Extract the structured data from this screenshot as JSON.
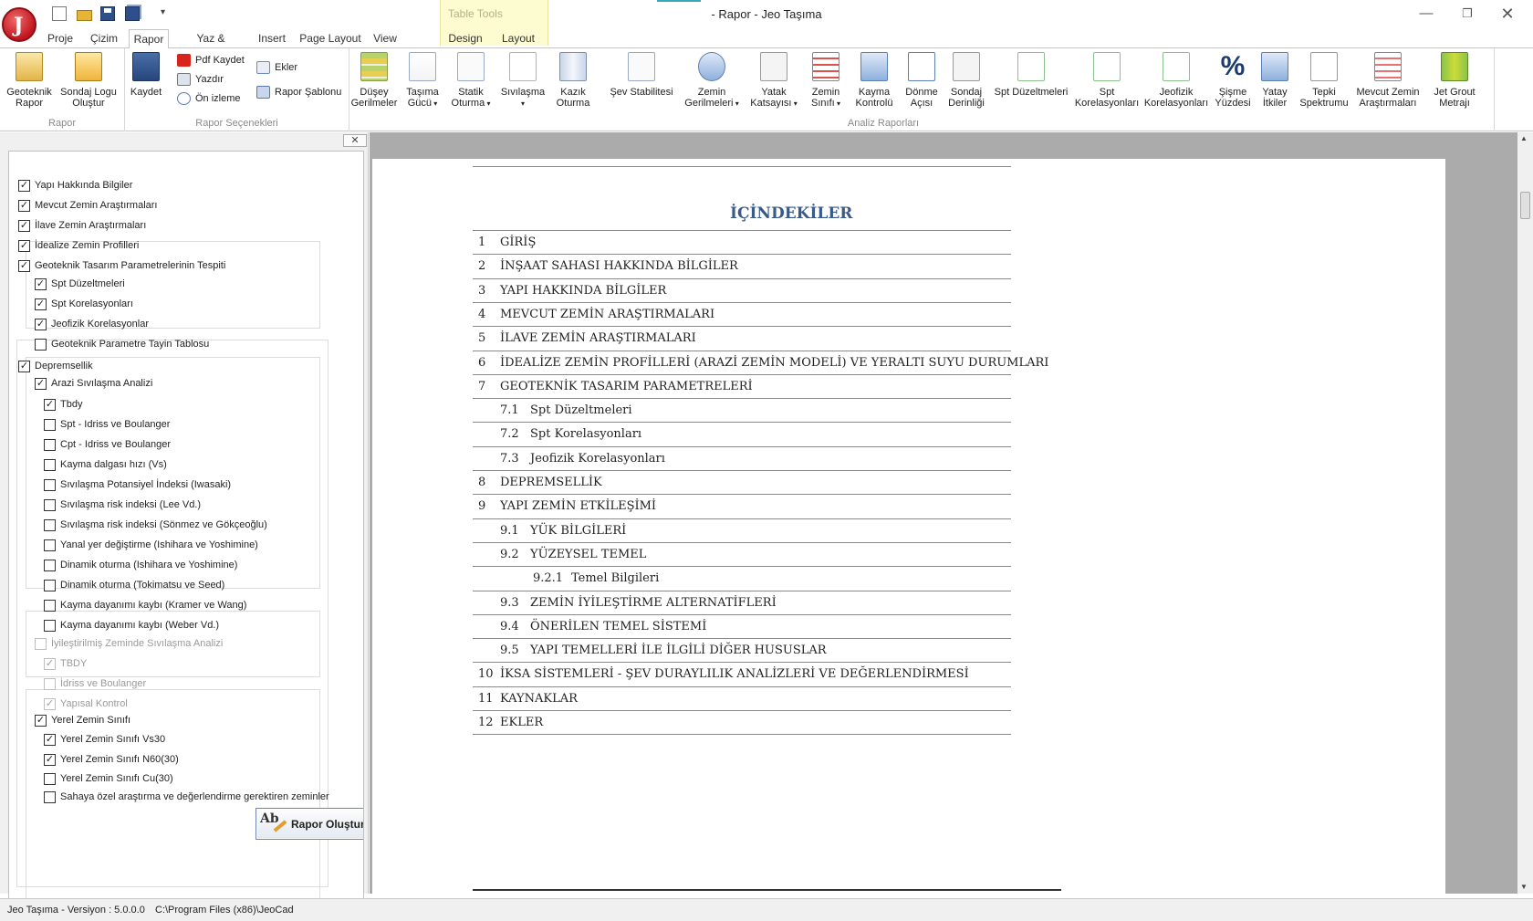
{
  "window": {
    "title": "- Rapor - Jeo Taşıma",
    "app_logo_letter": "J",
    "contextual_tab_group": "Table Tools",
    "minimize": "—",
    "maximize": "❐",
    "close": "✕"
  },
  "tabs": [
    "Proje",
    "Çizim",
    "Rapor",
    "Yaz & Düzenle",
    "Insert",
    "Page Layout",
    "View",
    "Design",
    "Layout"
  ],
  "active_tab": "Rapor",
  "ribbon": {
    "groups": {
      "rapor": "Rapor",
      "secenekler": "Rapor Seçenekleri",
      "analiz": "Analiz Raporları"
    },
    "rapor_buttons": [
      {
        "label1": "Geoteknik",
        "label2": "Rapor"
      },
      {
        "label1": "Sondaj Logu",
        "label2": "Oluştur"
      }
    ],
    "kaydet": "Kaydet",
    "pdf_kaydet": "Pdf Kaydet",
    "yazdir": "Yazdır",
    "on_izleme": "Ön izleme",
    "ekler": "Ekler",
    "rapor_sablonu": "Rapor Şablonu",
    "analiz_buttons": [
      {
        "label1": "Düşey",
        "label2": "Gerilmeler",
        "icon": "stress-layers-icon"
      },
      {
        "label1": "Taşıma",
        "label2": "Gücü",
        "icon": "bearing-capacity-icon"
      },
      {
        "label1": "Statik",
        "label2": "Oturma",
        "icon": "static-settlement-icon"
      },
      {
        "label1": "Sıvılaşma",
        "label2": "",
        "icon": "liquefaction-icon"
      },
      {
        "label1": "Kazık",
        "label2": "Oturma",
        "icon": "pile-settlement-icon"
      },
      {
        "label1": "Şev Stabilitesi",
        "label2": "",
        "icon": "slope-stability-icon"
      },
      {
        "label1": "Zemin",
        "label2": "Gerilmeleri",
        "icon": "soil-stress-icon"
      },
      {
        "label1": "Yatak",
        "label2": "Katsayısı",
        "icon": "subgrade-modulus-icon"
      },
      {
        "label1": "Zemin",
        "label2": "Sınıfı",
        "icon": "soil-class-icon"
      },
      {
        "label1": "Kayma",
        "label2": "Kontrolü",
        "icon": "sliding-check-icon"
      },
      {
        "label1": "Dönme",
        "label2": "Açısı",
        "icon": "rotation-angle-icon"
      },
      {
        "label1": "Sondaj",
        "label2": "Derinliği",
        "icon": "boring-depth-icon"
      },
      {
        "label1": "Spt Düzeltmeleri",
        "label2": "",
        "icon": "spt-correction-icon"
      },
      {
        "label1": "Spt",
        "label2": "Korelasyonları",
        "icon": "spt-correlation-icon"
      },
      {
        "label1": "Jeofizik",
        "label2": "Korelasyonları",
        "icon": "geophysics-correlation-icon"
      },
      {
        "label1": "Şişme",
        "label2": "Yüzdesi",
        "icon": "percent-icon",
        "glyph": "%"
      },
      {
        "label1": "Yatay",
        "label2": "İtkiler",
        "icon": "lateral-pressure-icon"
      },
      {
        "label1": "Tepki",
        "label2": "Spektrumu",
        "icon": "response-spectrum-icon"
      },
      {
        "label1": "Mevcut Zemin",
        "label2": "Araştırmaları",
        "icon": "existing-survey-icon"
      },
      {
        "label1": "Jet Grout",
        "label2": "Metrajı",
        "icon": "jet-grout-icon"
      }
    ]
  },
  "tree": {
    "close": "✕",
    "items": [
      {
        "label": "Yapı Hakkında Bilgiler",
        "checked": true,
        "enabled": true
      },
      {
        "label": "Mevcut Zemin Araştırmaları",
        "checked": true,
        "enabled": true
      },
      {
        "label": "İlave Zemin Araştırmaları",
        "checked": true,
        "enabled": true
      },
      {
        "label": "İdealize Zemin Profilleri",
        "checked": true,
        "enabled": true
      },
      {
        "label": "Geoteknik Tasarım Parametrelerinin Tespiti",
        "checked": true,
        "enabled": true
      },
      {
        "label": "Spt Düzeltmeleri",
        "checked": true,
        "enabled": true
      },
      {
        "label": "Spt Korelasyonları",
        "checked": true,
        "enabled": true
      },
      {
        "label": "Jeofizik Korelasyonlar",
        "checked": true,
        "enabled": true
      },
      {
        "label": "Geoteknik Parametre Tayin Tablosu",
        "checked": false,
        "enabled": true
      },
      {
        "label": "Depremsellik",
        "checked": true,
        "enabled": true
      },
      {
        "label": "Arazi Sıvılaşma Analizi",
        "checked": true,
        "enabled": true
      },
      {
        "label": "Tbdy",
        "checked": true,
        "enabled": true
      },
      {
        "label": "Spt - Idriss ve Boulanger",
        "checked": false,
        "enabled": true
      },
      {
        "label": "Cpt - Idriss ve Boulanger",
        "checked": false,
        "enabled": true
      },
      {
        "label": "Kayma dalgası hızı (Vs)",
        "checked": false,
        "enabled": true
      },
      {
        "label": "Sıvılaşma Potansiyel İndeksi (Iwasaki)",
        "checked": false,
        "enabled": true
      },
      {
        "label": "Sıvılaşma risk indeksi (Lee Vd.)",
        "checked": false,
        "enabled": true
      },
      {
        "label": "Sıvılaşma risk indeksi  (Sönmez ve Gökçeoğlu)",
        "checked": false,
        "enabled": true
      },
      {
        "label": "Yanal yer değiştirme (Ishihara ve Yoshimine)",
        "checked": false,
        "enabled": true
      },
      {
        "label": "Dinamik oturma (Ishihara ve Yoshimine)",
        "checked": false,
        "enabled": true
      },
      {
        "label": "Dinamik oturma (Tokimatsu ve Seed)",
        "checked": false,
        "enabled": true
      },
      {
        "label": "Kayma dayanımı kaybı (Kramer ve Wang)",
        "checked": false,
        "enabled": true
      },
      {
        "label": "Kayma dayanımı kaybı (Weber Vd.)",
        "checked": false,
        "enabled": true
      },
      {
        "label": "İyileştirilmiş Zeminde Sıvılaşma Analizi",
        "checked": false,
        "enabled": false
      },
      {
        "label": "TBDY",
        "checked": true,
        "enabled": false
      },
      {
        "label": "İdriss ve Boulanger",
        "checked": false,
        "enabled": false
      },
      {
        "label": "Yapısal Kontrol",
        "checked": true,
        "enabled": false
      },
      {
        "label": "Yerel Zemin Sınıfı",
        "checked": true,
        "enabled": true
      },
      {
        "label": "Yerel Zemin Sınıfı Vs30",
        "checked": true,
        "enabled": true
      },
      {
        "label": "Yerel Zemin Sınıfı N60(30)",
        "checked": true,
        "enabled": true
      },
      {
        "label": "Yerel Zemin Sınıfı Cu(30)",
        "checked": false,
        "enabled": true
      },
      {
        "label": "Sahaya özel araştırma ve değerlendirme gerektiren zeminler",
        "checked": false,
        "enabled": true
      }
    ],
    "create_button": "Rapor Oluştur",
    "create_icon_text": "Ab"
  },
  "document": {
    "toc_title": "İÇİNDEKİLER",
    "toc": [
      {
        "num": "1",
        "text": "GİRİŞ",
        "level": 0
      },
      {
        "num": "2",
        "text": "İNŞAAT SAHASI HAKKINDA BİLGİLER",
        "level": 0
      },
      {
        "num": "3",
        "text": "YAPI HAKKINDA BİLGİLER",
        "level": 0
      },
      {
        "num": "4",
        "text": "MEVCUT ZEMİN ARAŞTIRMALARI",
        "level": 0
      },
      {
        "num": "5",
        "text": "İLAVE ZEMİN ARAŞTIRMALARI",
        "level": 0
      },
      {
        "num": "6",
        "text": "İDEALİZE ZEMİN PROFİLLERİ (ARAZİ ZEMİN MODELİ) VE YERALTI SUYU DURUMLARI",
        "level": 0
      },
      {
        "num": "7",
        "text": "GEOTEKNİK TASARIM PARAMETRELERİ",
        "level": 0
      },
      {
        "num": "7.1",
        "text": "Spt Düzeltmeleri",
        "level": 1
      },
      {
        "num": "7.2",
        "text": "Spt Korelasyonları",
        "level": 1
      },
      {
        "num": "7.3",
        "text": "Jeofizik Korelasyonları",
        "level": 1
      },
      {
        "num": "8",
        "text": "DEPREMSELLİK",
        "level": 0
      },
      {
        "num": "9",
        "text": "YAPI ZEMİN ETKİLEŞİMİ",
        "level": 0
      },
      {
        "num": "9.1",
        "text": "YÜK BİLGİLERİ",
        "level": 1
      },
      {
        "num": "9.2",
        "text": "YÜZEYSEL TEMEL",
        "level": 1
      },
      {
        "num": "9.2.1",
        "text": "Temel Bilgileri",
        "level": 2
      },
      {
        "num": "9.3",
        "text": "ZEMİN İYİLEŞTİRME ALTERNATİFLERİ",
        "level": 1
      },
      {
        "num": "9.4",
        "text": "ÖNERİLEN TEMEL SİSTEMİ",
        "level": 1
      },
      {
        "num": "9.5",
        "text": "YAPI TEMELLERİ İLE İLGİLİ DİĞER HUSUSLAR",
        "level": 1
      },
      {
        "num": "10",
        "text": "İKSA SİSTEMLERİ - ŞEV DURAYLILIK ANALİZLERİ VE DEĞERLENDİRMESİ",
        "level": 0
      },
      {
        "num": "11",
        "text": "KAYNAKLAR",
        "level": 0
      },
      {
        "num": "12",
        "text": "EKLER",
        "level": 0
      }
    ]
  },
  "status": {
    "version": "Jeo Taşıma - Versiyon : 5.0.0.0",
    "path": "C:\\Program Files (x86)\\JeoCad"
  }
}
